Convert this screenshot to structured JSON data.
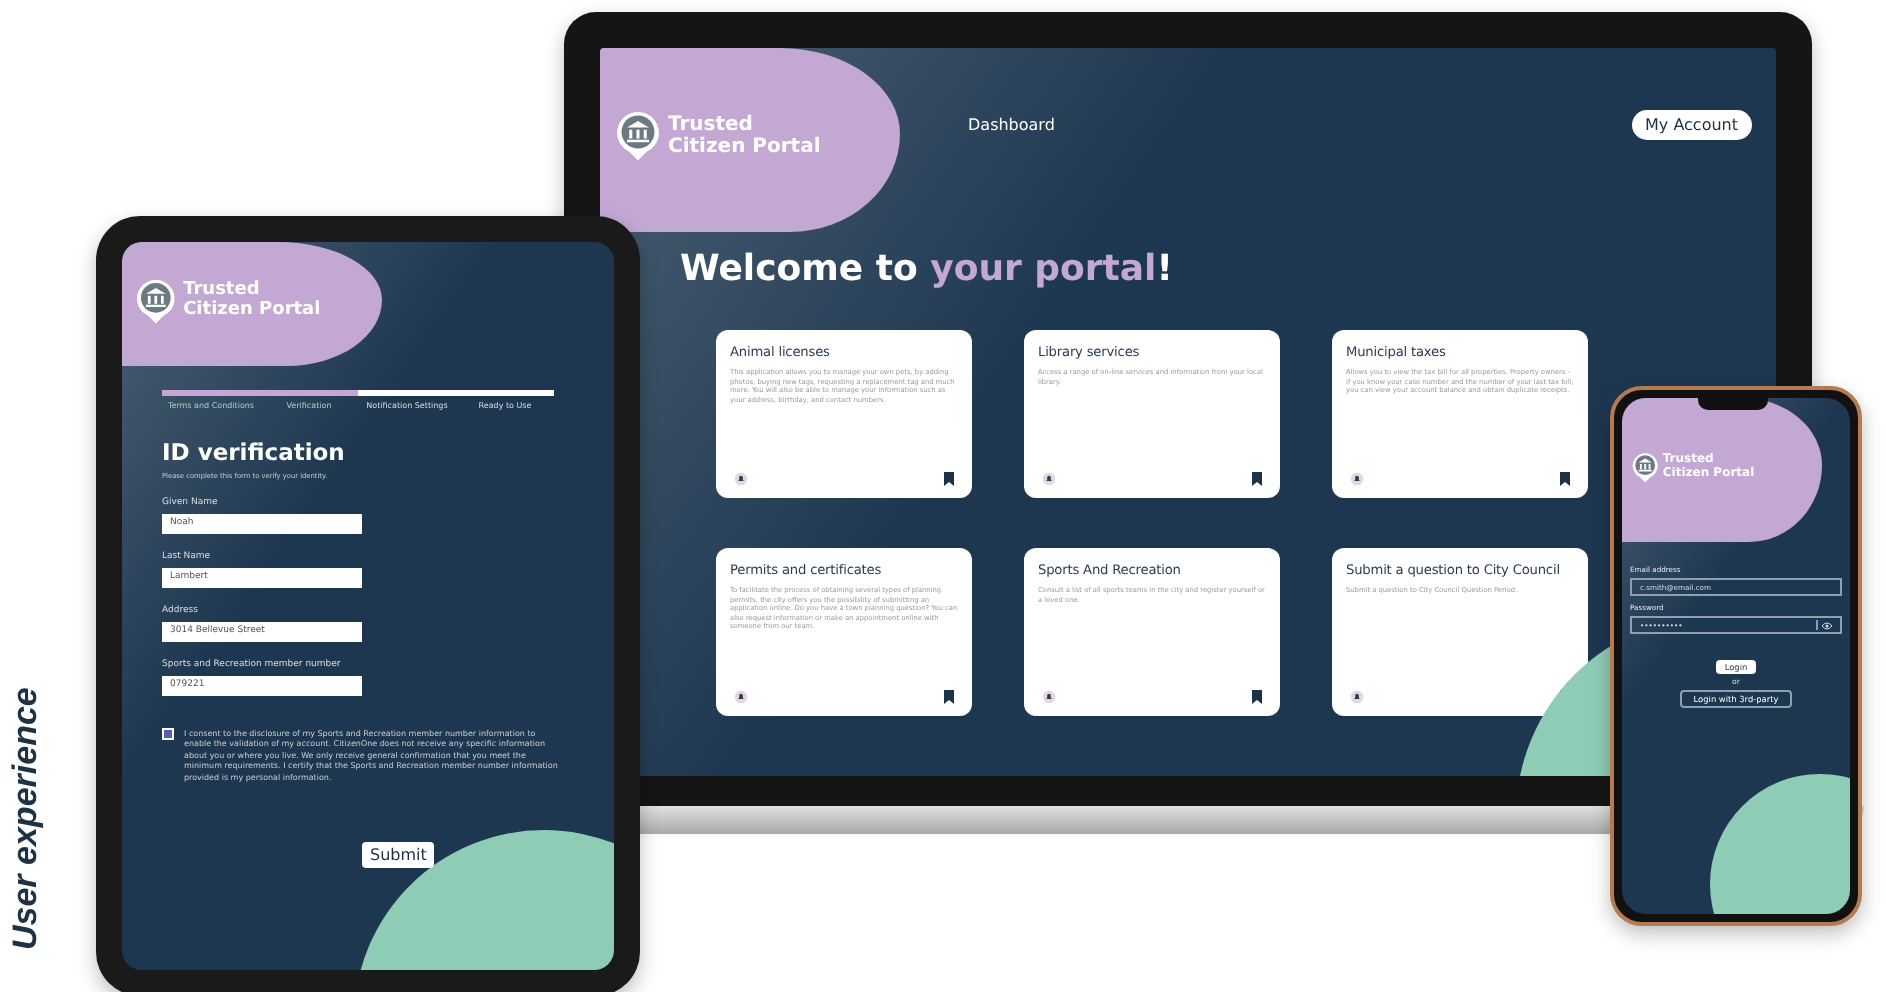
{
  "side_label": "User experience",
  "laptop": {
    "brand": {
      "line1": "Trusted",
      "line2": "Citizen Portal"
    },
    "nav_link": "Dashboard",
    "account_button": "My Account",
    "heading": {
      "start": "Welcome to",
      "highlight": "your portal",
      "end": "!"
    },
    "cards": [
      {
        "title": "Animal licenses",
        "description": "This application allows you to manage your own pets, by adding photos, buying new tags, requesting a replacement tag and much more. You will also be able to manage your information such as your address, birthday, and contact numbers."
      },
      {
        "title": "Library services",
        "description": "Access a range of on-line services and information from your local library."
      },
      {
        "title": "Municipal taxes",
        "description": "Allows you to view the tax bill for all properties. Property owners - if you know your case number and the number of your last tax bill, you can view your account balance and obtain duplicate receipts."
      },
      {
        "title": "Permits and certificates",
        "description": "To facilitate the process of obtaining several types of planning permits, the city offers you the possibility of submitting an application online. Do you have a town planning question? You can also request information or make an appointment online with someone from our team."
      },
      {
        "title": "Sports And Recreation",
        "description": "Consult a list of all sports teams in the city and register yourself or a loved one."
      },
      {
        "title": "Submit a question to City Council",
        "description": "Submit a question to City Council Question Period."
      }
    ]
  },
  "tablet": {
    "brand": {
      "line1": "Trusted",
      "line2": "Citizen Portal"
    },
    "steps": [
      {
        "label": "Terms and Conditions",
        "done": true
      },
      {
        "label": "Verification",
        "done": true
      },
      {
        "label": "Notification Settings",
        "done": false
      },
      {
        "label": "Ready to Use",
        "done": false
      }
    ],
    "title": "ID verification",
    "subtitle": "Please complete this form to verify your identity.",
    "fields": [
      {
        "label": "Given Name",
        "value": "Noah"
      },
      {
        "label": "Last Name",
        "value": "Lambert"
      },
      {
        "label": "Address",
        "value": "3014 Bellevue Street"
      },
      {
        "label": "Sports and Recreation member number",
        "value": "079221"
      }
    ],
    "consent": {
      "checked": true,
      "text": "I consent to the disclosure of my Sports and Recreation member number information to enable the validation of my account. CitizenOne does not receive any specific information about you or where you live. We only receive general confirmation that you meet the minimum requirements. I certify that the Sports and Recreation member number information provided is my personal information."
    },
    "submit": "Submit"
  },
  "phone": {
    "brand": {
      "line1": "Trusted",
      "line2": "Citizen Portal"
    },
    "email_label": "Email address",
    "email": "c.smith@email.com",
    "password_label": "Password",
    "password": "••••••••••",
    "login": "Login",
    "or": "or",
    "third_party": "Login with 3rd-party"
  }
}
